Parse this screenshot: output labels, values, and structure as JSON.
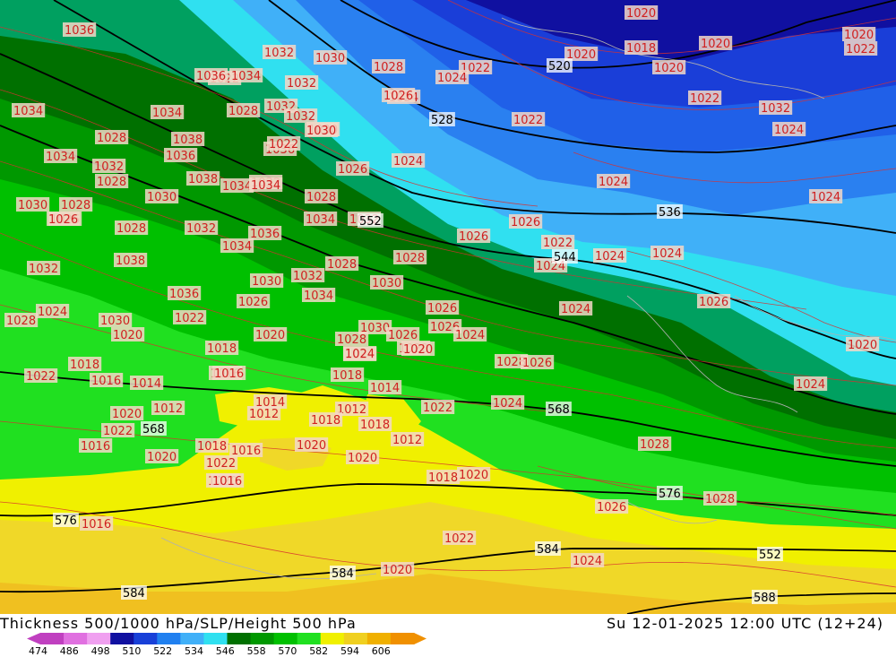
{
  "title_left": "Thickness 500/1000 hPa/SLP/Height 500 hPa",
  "title_right": "Su 12-01-2025 12:00 UTC (12+24)",
  "colorbar": {
    "labels": [
      "474",
      "486",
      "498",
      "510",
      "522",
      "534",
      "546",
      "558",
      "570",
      "582",
      "594",
      "606"
    ],
    "colors": [
      "#c040c0",
      "#e070e0",
      "#f0a0f0",
      "#1010a0",
      "#1840d8",
      "#2080f0",
      "#40b0f8",
      "#30e0f0",
      "#007000",
      "#009800",
      "#00c000",
      "#20e020",
      "#f0f000",
      "#f0d020",
      "#f0b000",
      "#f09000"
    ]
  },
  "height_labels": [
    "520",
    "528",
    "536",
    "544",
    "552",
    "568",
    "568",
    "576",
    "576",
    "584",
    "584",
    "584",
    "588",
    "552"
  ],
  "slp_labels": [
    "1020",
    "1018",
    "1020",
    "1022",
    "1020",
    "1024",
    "1022",
    "1036",
    "1032",
    "1030",
    "1028",
    "1022",
    "1024",
    "1020",
    "1020",
    "1036",
    "1034",
    "1032",
    "1026",
    "1034",
    "1032",
    "1028",
    "1034",
    "1032",
    "1030",
    "1022",
    "1022",
    "1024",
    "1032",
    "1038",
    "1028",
    "1032",
    "1034",
    "1036",
    "1026",
    "1024",
    "1034",
    "1032",
    "1028",
    "1038",
    "1036",
    "1034",
    "1030",
    "1028",
    "1026",
    "1022",
    "1024",
    "1030",
    "1028",
    "1030",
    "1026",
    "1032",
    "1034",
    "1024",
    "1026",
    "1032",
    "1036",
    "1038",
    "1028",
    "1032",
    "1034",
    "1028",
    "1026",
    "1030",
    "1022",
    "1024",
    "1028",
    "1030",
    "1036",
    "1032",
    "1026",
    "1034",
    "1030",
    "1028",
    "1024",
    "1026",
    "1020",
    "1030",
    "1028",
    "1026",
    "1024",
    "1020",
    "1020",
    "1018",
    "1016",
    "1018",
    "1022",
    "1024",
    "1022",
    "1026",
    "1026",
    "1024",
    "1028",
    "1024",
    "1018",
    "1016",
    "1014",
    "1020",
    "1012",
    "1012",
    "1014",
    "1012",
    "1018",
    "1016",
    "1016",
    "1022",
    "1020",
    "1020",
    "1018",
    "1012",
    "1020",
    "1024",
    "1022",
    "1020",
    "1020",
    "1016",
    "1018",
    "1020",
    "1018",
    "1020",
    "1024",
    "1014",
    "1016",
    "1016",
    "1026",
    "1028",
    "1024",
    "1022",
    "1024",
    "1026",
    "1028",
    "1022",
    "1024",
    "1020"
  ]
}
